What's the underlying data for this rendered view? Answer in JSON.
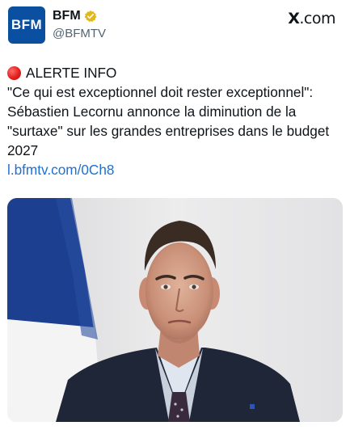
{
  "account": {
    "name": "BFM",
    "handle": "@BFMTV",
    "avatar_text": "BFM"
  },
  "source": {
    "label_x": "X",
    "label_rest": ".com"
  },
  "tweet": {
    "alert_label": "ALERTE INFO",
    "lines": [
      "\"Ce qui est exceptionnel doit rester exceptionnel\":",
      "Sébastien Lecornu annonce la diminution de la",
      "\"surtaxe\" sur les grandes entreprises dans le budget",
      "2027"
    ],
    "link": "l.bfmtv.com/0Ch8"
  },
  "icons": {
    "verified": "verified-badge-icon",
    "alert": "red-circle-icon"
  },
  "colors": {
    "brand_blue": "#0a4fa0",
    "link": "#1d71d6",
    "verified_gold": "#e2b719",
    "alert_red": "#e0201d"
  }
}
